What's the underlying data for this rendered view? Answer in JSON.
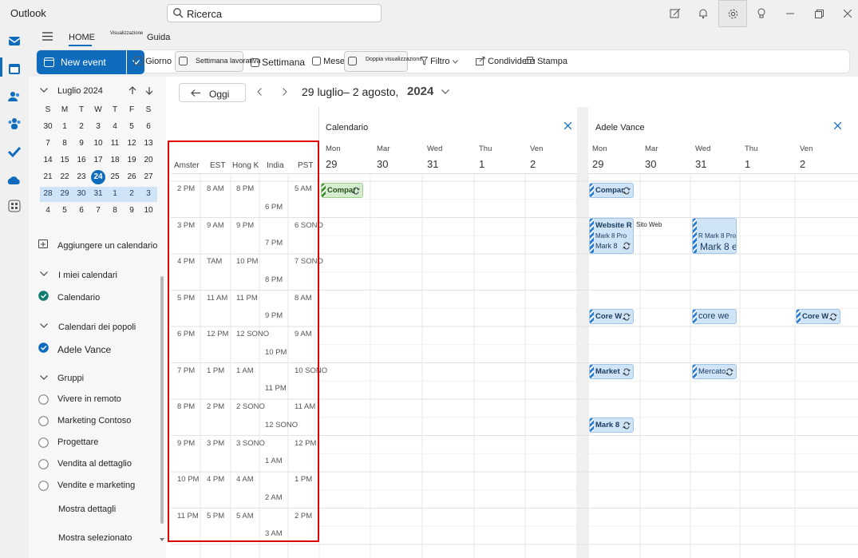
{
  "titlebar": {
    "app_name": "Outlook",
    "search_placeholder": "Ricerca"
  },
  "ribbon": {
    "tabs": [
      "HOME",
      "Visualizzazione",
      "Guida"
    ],
    "new_event": "New event",
    "giorno": "Giorno",
    "settimana_lavorativa": "Settimana lavorativa",
    "settimana": "Settimana",
    "mese": "Mese",
    "doppia": "Doppia visualizzazione",
    "filtro": "Filtro",
    "condividere": "Condividere",
    "stampa": "Stampa"
  },
  "mini_cal": {
    "month": "Luglio 2024",
    "weekday_heads": [
      "S",
      "M",
      "T",
      "W",
      "T",
      "F",
      "S"
    ],
    "weeks": [
      [
        "30",
        "1",
        "2",
        "3",
        "4",
        "5",
        "6"
      ],
      [
        "7",
        "8",
        "9",
        "10",
        "11",
        "12",
        "13"
      ],
      [
        "14",
        "15",
        "16",
        "17",
        "18",
        "19",
        "20"
      ],
      [
        "21",
        "22",
        "23",
        "24",
        "25",
        "26",
        "27"
      ],
      [
        "28",
        "29",
        "30",
        "31",
        "1",
        "2",
        "3"
      ],
      [
        "4",
        "5",
        "6",
        "7",
        "8",
        "9",
        "10"
      ]
    ],
    "today": "24"
  },
  "left": {
    "add_calendar": "Aggiungere un calendario",
    "my_calendars": "I miei calendari",
    "calendario": "Calendario",
    "people_calendars": "Calendari dei popoli",
    "adele": "Adele Vance",
    "groups": "Gruppi",
    "group_items": [
      "Vivere in remoto",
      "Marketing Contoso",
      "Progettare",
      "Vendita al dettaglio",
      "Vendite e marketing"
    ],
    "show_details": "Mostra dettagli",
    "show_selected": "Mostra selezionato"
  },
  "nav": {
    "today_btn": "Oggi",
    "range": "29 luglio– 2 agosto,",
    "year": "2024"
  },
  "timezones": {
    "headers": [
      "Amsterdam",
      "EST",
      "Hong K",
      "India",
      "PST"
    ],
    "rows": [
      [
        "2 PM",
        "8 AM",
        "8 PM",
        "",
        "5 AM"
      ],
      [
        "",
        "",
        "",
        "6 PM",
        ""
      ],
      [
        "3 PM",
        "9 AM",
        "9 PM",
        "",
        "6 SONO"
      ],
      [
        "",
        "",
        "",
        "7 PM",
        ""
      ],
      [
        "4 PM",
        "TAM",
        "10 PM",
        "",
        "7 SONO"
      ],
      [
        "",
        "",
        "",
        "8 PM",
        ""
      ],
      [
        "5 PM",
        "11 AM",
        "11 PM",
        "",
        "8 AM"
      ],
      [
        "",
        "",
        "",
        "9 PM",
        ""
      ],
      [
        "6 PM",
        "12 PM",
        "12 SONO",
        "",
        "9 AM"
      ],
      [
        "",
        "",
        "",
        "10 PM",
        ""
      ],
      [
        "7 PM",
        "1 PM",
        "1 AM",
        "",
        "10 SONO"
      ],
      [
        "",
        "",
        "",
        "11 PM",
        ""
      ],
      [
        "8 PM",
        "2 PM",
        "2 SONO",
        "",
        "11 AM"
      ],
      [
        "",
        "",
        "",
        "12 SONO",
        ""
      ],
      [
        "9 PM",
        "3 PM",
        "3 SONO",
        "",
        "12 PM"
      ],
      [
        "",
        "",
        "",
        "1 AM",
        ""
      ],
      [
        "10 PM",
        "4 PM",
        "4 AM",
        "",
        "1 PM"
      ],
      [
        "",
        "",
        "",
        "2 AM",
        ""
      ],
      [
        "11 PM",
        "5 PM",
        "5 AM",
        "",
        "2 PM"
      ],
      [
        "",
        "",
        "",
        "3 AM",
        ""
      ]
    ]
  },
  "calendars": [
    {
      "name": "Calendario",
      "days": [
        {
          "d": "Mon",
          "n": "29"
        },
        {
          "d": "Mar",
          "n": "30"
        },
        {
          "d": "Wed",
          "n": "31"
        },
        {
          "d": "Thu",
          "n": "1"
        },
        {
          "d": "Ven",
          "n": "2"
        }
      ]
    },
    {
      "name": "Adele Vance",
      "days": [
        {
          "d": "Mon",
          "n": "29"
        },
        {
          "d": "Mar",
          "n": "30"
        },
        {
          "d": "Wed",
          "n": "31"
        },
        {
          "d": "Thu",
          "n": "1"
        },
        {
          "d": "Ven",
          "n": "2"
        }
      ]
    }
  ],
  "events": {
    "cal1_compar": "Compar",
    "a_compar": "Compar",
    "a_website_title": "Website R",
    "a_website_sub": "Mark 8 Pro",
    "a_website_sub2": "Mark 8",
    "sito_web": "Sito Web",
    "a_wed_sub": "R Mark 8 Pro",
    "a_wed_title": "Mark 8 e",
    "a_core_mon": "Core W",
    "a_core_wed": "core we",
    "a_core_fri": "Core W",
    "a_market": "Market",
    "a_mercato": "Mercato",
    "a_mark8": "Mark 8"
  },
  "colors": {
    "accent": "#0f6cbd",
    "highlight": "#e00000"
  }
}
